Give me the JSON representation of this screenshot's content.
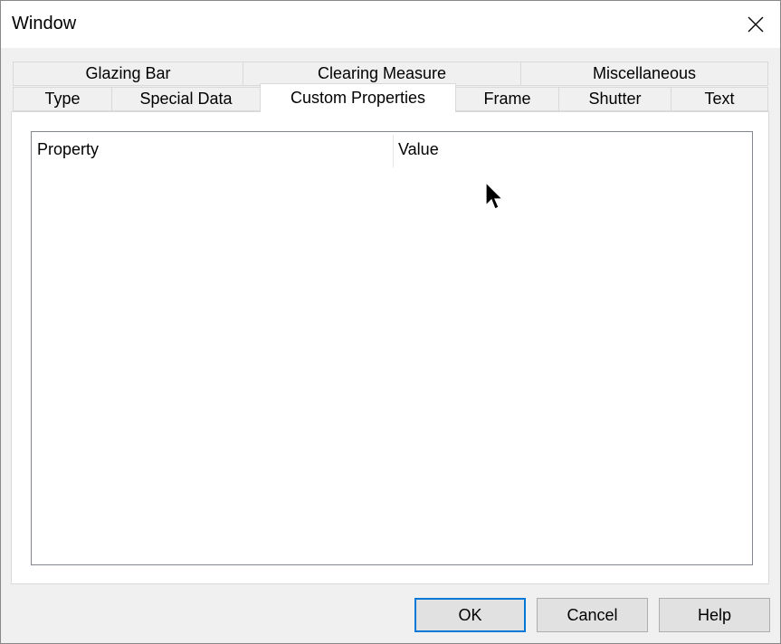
{
  "window": {
    "title": "Window",
    "close_icon": "close-icon"
  },
  "tabs": {
    "row_back": [
      {
        "label": "Glazing Bar"
      },
      {
        "label": "Clearing Measure"
      },
      {
        "label": "Miscellaneous"
      }
    ],
    "row_front": [
      {
        "label": "Type"
      },
      {
        "label": "Special Data"
      },
      {
        "label": "Custom Properties",
        "active": true
      },
      {
        "label": "Frame"
      },
      {
        "label": "Shutter"
      },
      {
        "label": "Text"
      }
    ]
  },
  "listview": {
    "columns": [
      {
        "label": "Property"
      },
      {
        "label": "Value"
      }
    ],
    "rows": []
  },
  "buttons": {
    "ok": "OK",
    "cancel": "Cancel",
    "help": "Help"
  },
  "colors": {
    "accent": "#0078d7",
    "dialog_bg": "#f0f0f0",
    "panel_bg": "#ffffff"
  }
}
